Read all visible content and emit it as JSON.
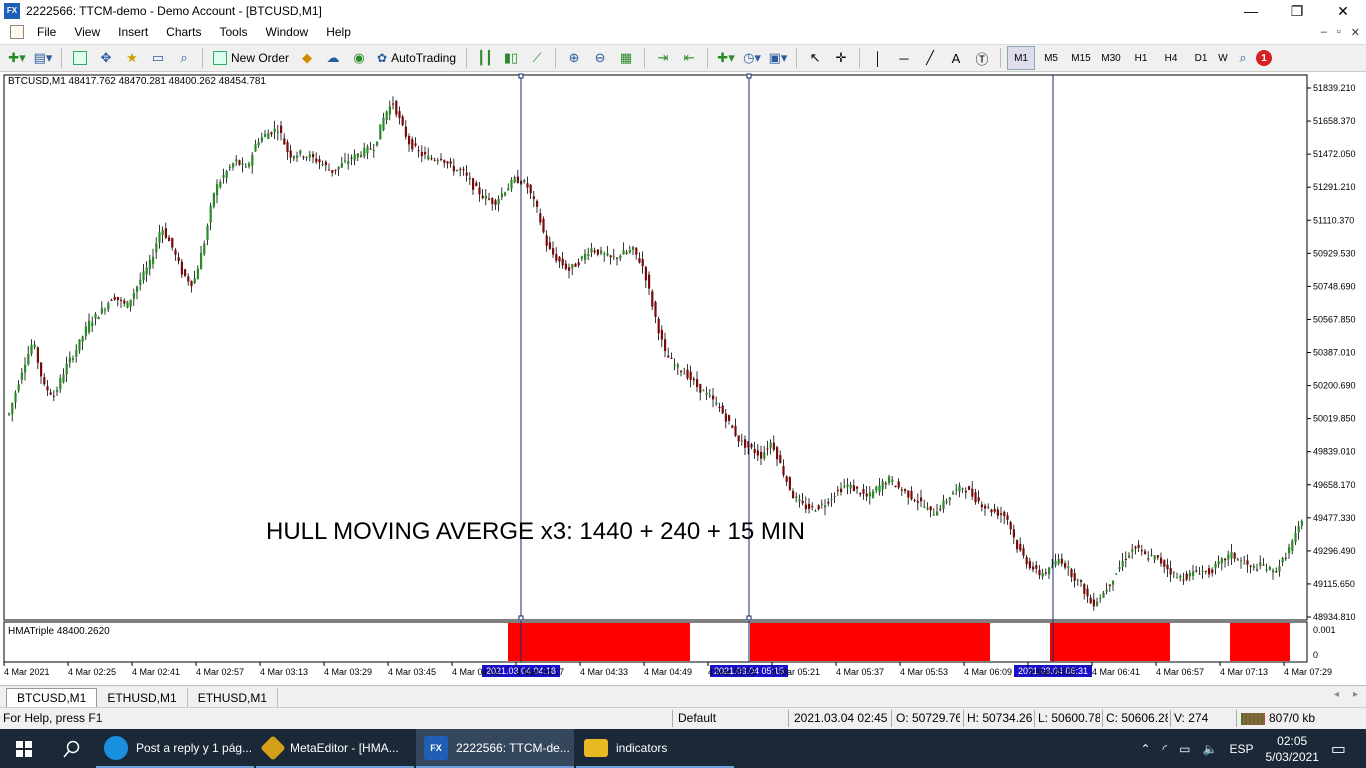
{
  "window": {
    "title": "2222566: TTCM-demo - Demo Account - [BTCUSD,M1]",
    "controls": {
      "minimize": "—",
      "maximize": "❐",
      "close": "✕"
    },
    "app_icon_text": "FX"
  },
  "menu": [
    "File",
    "View",
    "Insert",
    "Charts",
    "Tools",
    "Window",
    "Help"
  ],
  "mdi_controls": {
    "minimize": "–",
    "restore": "▫",
    "close": "✕"
  },
  "toolbar": {
    "new_order": "New Order",
    "autotrading": "AutoTrading",
    "text_tool": "A",
    "timeframes": [
      "M1",
      "M5",
      "M15",
      "M30",
      "H1",
      "H4",
      "D1",
      "W"
    ],
    "active_timeframe": "M1",
    "notification_count": "1"
  },
  "chart": {
    "header": "BTCUSD,M1  48417.762 48470.281 48400.262 48454.781",
    "indicator_label": "HMATriple 48400.2620",
    "overlay_text": "HULL MOVING AVERGE x3: 1440 + 240 + 15 MIN",
    "bull_color": "#2a8a2a",
    "bear_color": "#7a0a0a",
    "hma_color": "#ff0000",
    "vline_color": "#1a2a6e",
    "marker_bg": "#1a10c8"
  },
  "chart_data": {
    "type": "candlestick",
    "symbol": "BTCUSD",
    "timeframe": "M1",
    "y_ticks": [
      "51839.210",
      "51658.370",
      "51472.050",
      "51291.210",
      "51110.370",
      "50929.530",
      "50748.690",
      "50567.850",
      "50387.010",
      "50200.690",
      "50019.850",
      "49839.010",
      "49658.170",
      "49477.330",
      "49296.490",
      "49115.650",
      "48934.810"
    ],
    "ylim": [
      48934.81,
      51839.21
    ],
    "x_ticks": [
      "4 Mar 2021",
      "4 Mar 02:25",
      "4 Mar 02:41",
      "4 Mar 02:57",
      "4 Mar 03:13",
      "4 Mar 03:29",
      "4 Mar 03:45",
      "4 Mar 04:01",
      "4 Mar 04:17",
      "4 Mar 04:33",
      "4 Mar 04:49",
      "4 Mar 05:05",
      "4 Mar 05:21",
      "4 Mar 05:37",
      "4 Mar 05:53",
      "4 Mar 06:09",
      "4 Mar 06:25",
      "4 Mar 06:41",
      "4 Mar 06:57",
      "4 Mar 07:13",
      "4 Mar 07:29"
    ],
    "vlines": [
      {
        "label": "2021.03.04 04:18"
      },
      {
        "label": "2021.03.04 05:15"
      },
      {
        "label": "2021.03.04 06:31"
      }
    ],
    "price_path": [
      [
        0,
        50050
      ],
      [
        10,
        50300
      ],
      [
        18,
        50450
      ],
      [
        26,
        50200
      ],
      [
        34,
        50150
      ],
      [
        42,
        50300
      ],
      [
        50,
        50400
      ],
      [
        60,
        50550
      ],
      [
        70,
        50620
      ],
      [
        78,
        50700
      ],
      [
        88,
        50640
      ],
      [
        98,
        50780
      ],
      [
        106,
        50880
      ],
      [
        114,
        51080
      ],
      [
        122,
        50970
      ],
      [
        130,
        50820
      ],
      [
        138,
        50760
      ],
      [
        146,
        50980
      ],
      [
        154,
        51280
      ],
      [
        162,
        51370
      ],
      [
        170,
        51440
      ],
      [
        178,
        51390
      ],
      [
        186,
        51550
      ],
      [
        194,
        51590
      ],
      [
        202,
        51620
      ],
      [
        210,
        51470
      ],
      [
        218,
        51480
      ],
      [
        226,
        51460
      ],
      [
        234,
        51430
      ],
      [
        242,
        51380
      ],
      [
        250,
        51420
      ],
      [
        258,
        51460
      ],
      [
        266,
        51490
      ],
      [
        274,
        51520
      ],
      [
        282,
        51700
      ],
      [
        288,
        51760
      ],
      [
        294,
        51640
      ],
      [
        300,
        51540
      ],
      [
        308,
        51480
      ],
      [
        316,
        51450
      ],
      [
        324,
        51460
      ],
      [
        332,
        51400
      ],
      [
        340,
        51380
      ],
      [
        348,
        51300
      ],
      [
        356,
        51240
      ],
      [
        364,
        51210
      ],
      [
        372,
        51280
      ],
      [
        380,
        51340
      ],
      [
        388,
        51310
      ],
      [
        396,
        51170
      ],
      [
        404,
        50960
      ],
      [
        412,
        50890
      ],
      [
        420,
        50840
      ],
      [
        428,
        50890
      ],
      [
        436,
        50960
      ],
      [
        444,
        50930
      ],
      [
        452,
        50900
      ],
      [
        460,
        50930
      ],
      [
        468,
        50950
      ],
      [
        476,
        50850
      ],
      [
        484,
        50600
      ],
      [
        492,
        50380
      ],
      [
        500,
        50310
      ],
      [
        508,
        50270
      ],
      [
        516,
        50200
      ],
      [
        524,
        50150
      ],
      [
        532,
        50090
      ],
      [
        540,
        50000
      ],
      [
        548,
        49900
      ],
      [
        556,
        49860
      ],
      [
        564,
        49820
      ],
      [
        572,
        49900
      ],
      [
        580,
        49740
      ],
      [
        588,
        49600
      ],
      [
        596,
        49540
      ],
      [
        604,
        49530
      ],
      [
        612,
        49560
      ],
      [
        620,
        49620
      ],
      [
        628,
        49660
      ],
      [
        636,
        49630
      ],
      [
        644,
        49590
      ],
      [
        652,
        49650
      ],
      [
        660,
        49690
      ],
      [
        668,
        49640
      ],
      [
        676,
        49600
      ],
      [
        684,
        49560
      ],
      [
        692,
        49500
      ],
      [
        700,
        49550
      ],
      [
        708,
        49620
      ],
      [
        716,
        49650
      ],
      [
        724,
        49590
      ],
      [
        732,
        49540
      ],
      [
        740,
        49510
      ],
      [
        748,
        49490
      ],
      [
        756,
        49320
      ],
      [
        764,
        49230
      ],
      [
        772,
        49170
      ],
      [
        780,
        49190
      ],
      [
        788,
        49260
      ],
      [
        796,
        49180
      ],
      [
        804,
        49110
      ],
      [
        812,
        49000
      ],
      [
        820,
        49060
      ],
      [
        828,
        49150
      ],
      [
        836,
        49250
      ],
      [
        844,
        49320
      ],
      [
        852,
        49270
      ],
      [
        860,
        49260
      ],
      [
        868,
        49210
      ],
      [
        876,
        49150
      ],
      [
        884,
        49160
      ],
      [
        892,
        49190
      ],
      [
        900,
        49180
      ],
      [
        908,
        49230
      ],
      [
        916,
        49280
      ],
      [
        924,
        49240
      ],
      [
        932,
        49200
      ],
      [
        940,
        49220
      ],
      [
        948,
        49180
      ],
      [
        956,
        49250
      ],
      [
        964,
        49370
      ],
      [
        972,
        49490
      ]
    ],
    "hma_blocks": [
      [
        504,
        686
      ],
      [
        746,
        986
      ],
      [
        1046,
        1166
      ],
      [
        1226,
        1286
      ]
    ],
    "hma_ticks": [
      "0.001",
      "0"
    ]
  },
  "tabs": [
    "BTCUSD,M1",
    "ETHUSD,M1",
    "ETHUSD,M1"
  ],
  "tab_scroll": [
    "◂",
    "▸"
  ],
  "status": {
    "help": "For Help, press F1",
    "profile": "Default",
    "datetime": "2021.03.04 02:45",
    "open": "O: 50729.762",
    "high": "H: 50734.262",
    "low": "L: 50600.781",
    "close": "C: 50606.281",
    "volume": "V: 274",
    "traffic": "807/0 kb"
  },
  "taskbar": {
    "apps": [
      {
        "label": "Post a reply y 1 pág...",
        "icon": "edge-icon"
      },
      {
        "label": "MetaEditor - [HMA...",
        "icon": "metaeditor-icon"
      },
      {
        "label": "2222566: TTCM-de...",
        "icon": "fx-choice-icon",
        "icon_text": "FX"
      },
      {
        "label": "indicators",
        "icon": "folder-icon"
      }
    ],
    "language": "ESP",
    "time": "02:05",
    "date": "5/03/2021"
  }
}
